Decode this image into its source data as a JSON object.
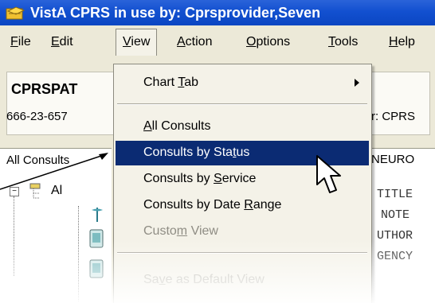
{
  "titlebar": {
    "title": "VistA CPRS in use by: Cprsprovider,Seven"
  },
  "menubar": {
    "items": [
      {
        "label_pre": "",
        "label_ul": "F",
        "label_post": "ile"
      },
      {
        "label_pre": "",
        "label_ul": "E",
        "label_post": "dit"
      },
      {
        "label_pre": "",
        "label_ul": "V",
        "label_post": "iew"
      },
      {
        "label_pre": "",
        "label_ul": "A",
        "label_post": "ction"
      },
      {
        "label_pre": "",
        "label_ul": "O",
        "label_post": "ptions"
      },
      {
        "label_pre": "",
        "label_ul": "T",
        "label_post": "ools"
      },
      {
        "label_pre": "",
        "label_ul": "H",
        "label_post": "elp"
      }
    ]
  },
  "patient": {
    "name": "CPRSPAT",
    "ssn": "666-23-657",
    "provider_partial": "r:  CPRS"
  },
  "left_pane": {
    "header": "All Consults",
    "tree_root": "Al"
  },
  "right_pane": {
    "service_header": "NEURO",
    "lines": [
      "TITLE",
      "NOTE",
      "UTHOR",
      "GENCY"
    ]
  },
  "view_menu": {
    "items": [
      {
        "pre": "Chart ",
        "ul": "T",
        "post": "ab",
        "state": "normal",
        "submenu": true
      },
      {
        "pre": "",
        "ul": "A",
        "post": "ll Consults",
        "state": "normal",
        "submenu": false
      },
      {
        "pre": "Consults by Sta",
        "ul": "t",
        "post": "us",
        "state": "highlight",
        "submenu": false
      },
      {
        "pre": "Consults by ",
        "ul": "S",
        "post": "ervice",
        "state": "normal",
        "submenu": false
      },
      {
        "pre": "Consults by Date ",
        "ul": "R",
        "post": "ange",
        "state": "normal",
        "submenu": false
      },
      {
        "pre": "Custo",
        "ul": "m",
        "post": " View",
        "state": "disabled",
        "submenu": false
      },
      {
        "pre": "Sa",
        "ul": "v",
        "post": "e as Default View",
        "state": "faded",
        "submenu": false
      }
    ]
  },
  "colors": {
    "titlebar": "#1250d0",
    "menu_highlight": "#0b2b73",
    "menu_background": "#f4f2e8"
  }
}
